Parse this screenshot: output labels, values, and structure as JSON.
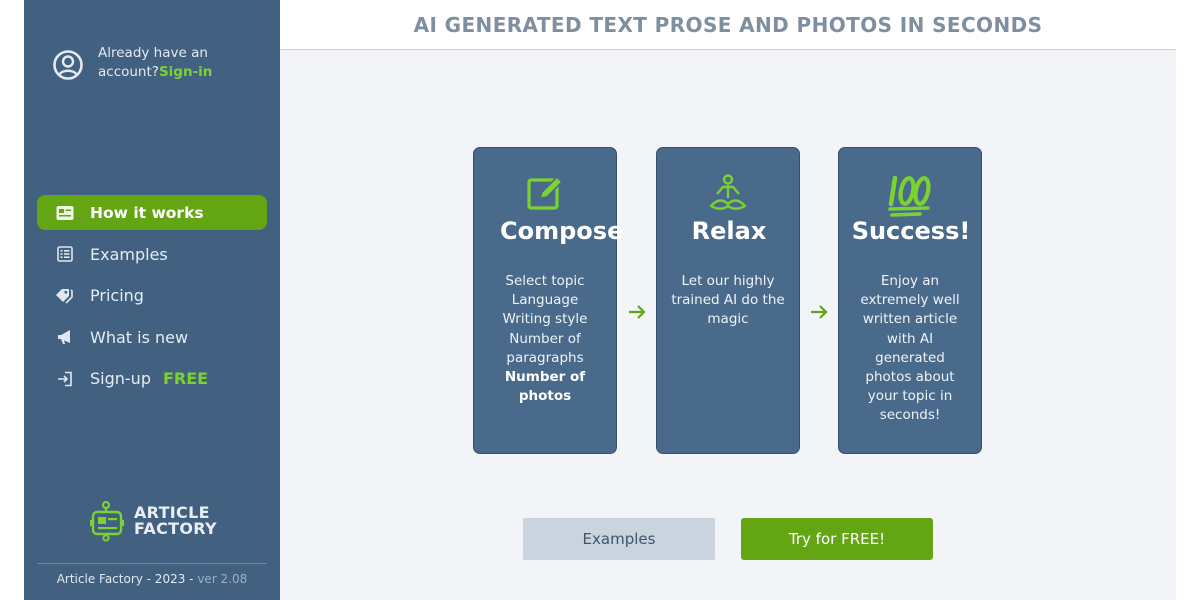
{
  "account": {
    "prompt": "Already have an account?",
    "signin_label": "Sign-in"
  },
  "nav": {
    "how_it_works": "How it works",
    "examples": "Examples",
    "pricing": "Pricing",
    "whats_new": "What is new",
    "signup": "Sign-up",
    "signup_badge": "FREE"
  },
  "logo": {
    "line1": "ARTICLE",
    "line2": "FACTORY"
  },
  "footer": {
    "text": "Article Factory - 2023 -",
    "version": "ver 2.08"
  },
  "header": {
    "title": "AI GENERATED TEXT PROSE AND PHOTOS IN SECONDS"
  },
  "steps": {
    "compose": {
      "title": "Compose",
      "lines": [
        "Select topic",
        "Language",
        "Writing style",
        "Number of paragraphs"
      ],
      "bold": "Number of photos"
    },
    "relax": {
      "title": "Relax",
      "text": "Let our highly trained AI do the magic"
    },
    "success": {
      "title": "Success!",
      "text": "Enjoy an extremely well written article with AI generated photos about your topic in seconds!"
    }
  },
  "buttons": {
    "examples": "Examples",
    "try": "Try for FREE!"
  },
  "colors": {
    "sidebar": "#42607f",
    "accent": "#63a513",
    "accent_text": "#7bd32f",
    "card": "#4a6a8b"
  },
  "icons": {
    "account": "user-circle-icon",
    "how_it_works": "id-card-icon",
    "examples": "list-icon",
    "pricing": "tags-icon",
    "whats_new": "megaphone-icon",
    "signup": "sign-in-icon",
    "compose": "edit-square-icon",
    "relax": "meditation-icon",
    "success": "hundred-points-icon"
  }
}
